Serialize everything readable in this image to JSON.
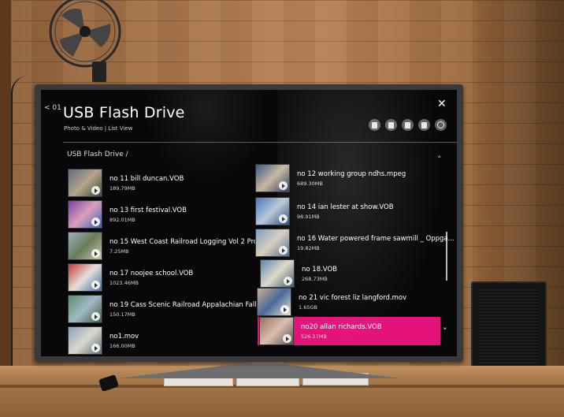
{
  "app": {
    "back_label": "< 01",
    "title": "USB Flash Drive",
    "subtitle": "Photo & Video | List View",
    "breadcrumb": "USB Flash Drive  /",
    "close_glyph": "✕",
    "scroll_up_glyph": "˄",
    "scroll_down_glyph": "˅"
  },
  "toolbar_icons": [
    "view-icon",
    "sort-icon",
    "select-icon",
    "copy-icon",
    "search-icon"
  ],
  "files": {
    "left": [
      {
        "name": "no 11 bill duncan.VOB",
        "size": "189.79MB"
      },
      {
        "name": "no 13 first festival.VOB",
        "size": "892.01MB"
      },
      {
        "name": "no 15  West Coast Railroad Logging Vol 2 Pro...",
        "size": "7.25MB"
      },
      {
        "name": "no 17 noojee school.VOB",
        "size": "1023.46MB"
      },
      {
        "name": "no 19 Cass Scenic Railroad Appalachian Fall F...",
        "size": "150.17MB"
      },
      {
        "name": "no1.mov",
        "size": "166.00MB"
      }
    ],
    "right": [
      {
        "name": "no 12 working group ndhs.mpeg",
        "size": "689.30MB"
      },
      {
        "name": "no 14 ian lester at show.VOB",
        "size": "98.91MB"
      },
      {
        "name": "no 16 Water powered frame sawmill _ Oppga...",
        "size": "19.82MB"
      },
      {
        "name": "no 18.VOB",
        "size": "268.73MB"
      },
      {
        "name": "no 21 vic forest liz langford.mov",
        "size": "1.65GB"
      },
      {
        "name": "no20  allan richards.VOB",
        "size": "526.27MB"
      }
    ]
  },
  "colors": {
    "selection": "#e4137a",
    "screen_bg": "#08080a"
  }
}
